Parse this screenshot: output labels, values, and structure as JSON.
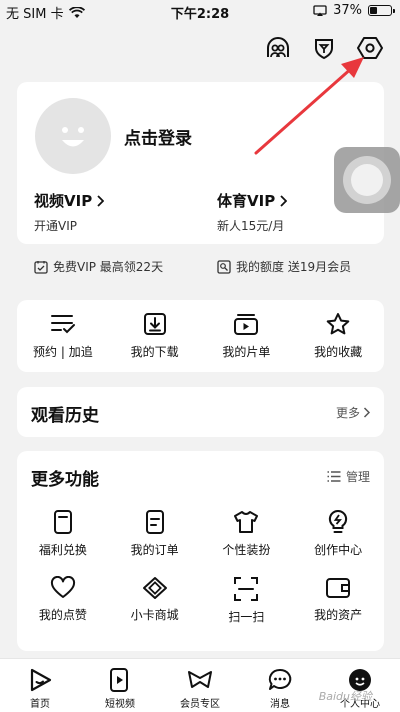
{
  "status_bar": {
    "carrier": "无 SIM 卡",
    "time": "下午2:28",
    "battery": "37%",
    "battery_level": 0.37
  },
  "top_icons": [
    "friends-icon",
    "shield-icon",
    "settings-hex-icon"
  ],
  "profile": {
    "login": "点击登录",
    "video_vip": {
      "title": "视频VIP",
      "sub": "开通VIP"
    },
    "sports_vip": {
      "title": "体育VIP",
      "sub": "新人15元/月"
    }
  },
  "vip_row": {
    "left": "免费VIP 最高领22天",
    "right": "我的额度 送19月会员"
  },
  "quick_actions": [
    {
      "label": "预约 | 加追",
      "icon": "list-check-icon"
    },
    {
      "label": "我的下载",
      "icon": "download-icon"
    },
    {
      "label": "我的片单",
      "icon": "playlist-icon"
    },
    {
      "label": "我的收藏",
      "icon": "star-icon"
    }
  ],
  "history": {
    "title": "观看历史",
    "more": "更多"
  },
  "features": {
    "title": "更多功能",
    "manage": "管理",
    "items": [
      {
        "label": "福利兑换",
        "icon": "gift-card-icon"
      },
      {
        "label": "我的订单",
        "icon": "order-icon"
      },
      {
        "label": "个性装扮",
        "icon": "tshirt-icon"
      },
      {
        "label": "创作中心",
        "icon": "bulb-icon"
      },
      {
        "label": "我的点赞",
        "icon": "heart-icon"
      },
      {
        "label": "小卡商城",
        "icon": "card-shop-icon"
      },
      {
        "label": "扫一扫",
        "icon": "scan-icon"
      },
      {
        "label": "我的资产",
        "icon": "wallet-icon"
      }
    ]
  },
  "tabs": [
    {
      "label": "首页",
      "icon": "home-play-icon"
    },
    {
      "label": "短视频",
      "icon": "short-video-icon"
    },
    {
      "label": "会员专区",
      "icon": "bowtie-icon"
    },
    {
      "label": "消息",
      "icon": "message-icon"
    },
    {
      "label": "个人中心",
      "icon": "profile-icon"
    }
  ],
  "watermark": "Baidu经验"
}
